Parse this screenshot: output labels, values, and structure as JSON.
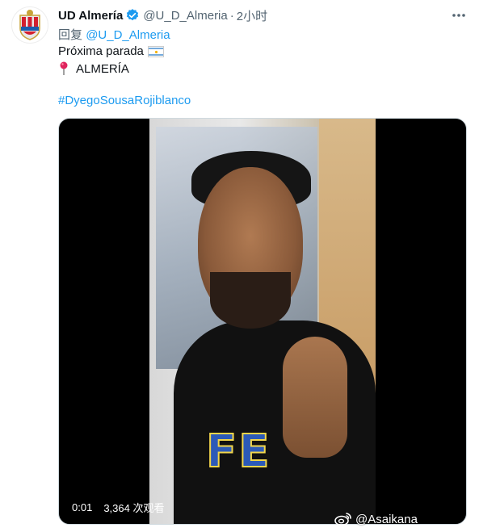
{
  "author": {
    "display_name": "UD Almería",
    "handle": "@U_D_Almeria",
    "separator": "·",
    "time": "2小时"
  },
  "reply": {
    "prefix": "回复",
    "mention": "@U_D_Almeria"
  },
  "body": {
    "line1": "Próxima parada",
    "line2": "ALMERÍA",
    "hashtag": "#DyegoSousaRojiblanco"
  },
  "video": {
    "elapsed": "0:01",
    "views": "3,364 次观看",
    "shirt_text": "FE"
  },
  "watermark": {
    "text": "@Asaikana"
  },
  "colors": {
    "link": "#1d9bf0",
    "muted": "#536471",
    "text": "#0f1419",
    "verified": "#1d9bf0"
  },
  "icons": {
    "avatar": "ud-almeria-crest-icon",
    "verified": "verified-badge-icon",
    "more": "more-horizontal-icon",
    "flag": "argentina-flag-icon",
    "pin": "round-pushpin-icon",
    "watermark": "weibo-icon"
  }
}
